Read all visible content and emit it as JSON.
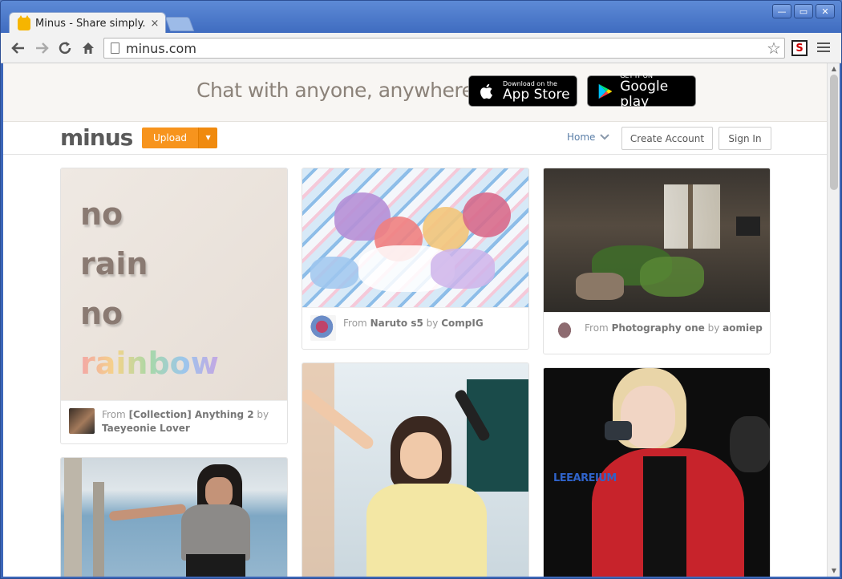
{
  "browser": {
    "tab_title": "Minus - Share simply.",
    "tab_close": "×",
    "url": "minus.com",
    "window_controls": {
      "minimize": "—",
      "maximize": "▭",
      "close": "✕"
    },
    "extension_label": "S"
  },
  "promo": {
    "headline": "Chat with anyone, anywhere.",
    "app_store": {
      "small": "Download on the",
      "big": "App Store"
    },
    "google_play": {
      "small": "GET IT ON",
      "big": "Google play"
    }
  },
  "header": {
    "logo": "minus",
    "upload_label": "Upload",
    "home_label": "Home",
    "create_account_label": "Create Account",
    "sign_in_label": "Sign In"
  },
  "cards": [
    {
      "image_text": [
        "no",
        "rain",
        "no",
        "rainbow"
      ],
      "from": "From",
      "collection": "[Collection] Anything 2",
      "by": "by",
      "author": "Taeyeonie Lover"
    },
    {
      "from": "From",
      "collection": "Naruto s5",
      "by": "by",
      "author": "CompIG"
    },
    {
      "from": "From",
      "collection": "Photography one",
      "by": "by",
      "author": "aomiep"
    },
    {},
    {},
    {
      "watermark": "LEEAREIUM"
    }
  ],
  "colors": {
    "accent": "#f7941d",
    "link": "#5b7fa8",
    "text_muted": "#999999"
  }
}
